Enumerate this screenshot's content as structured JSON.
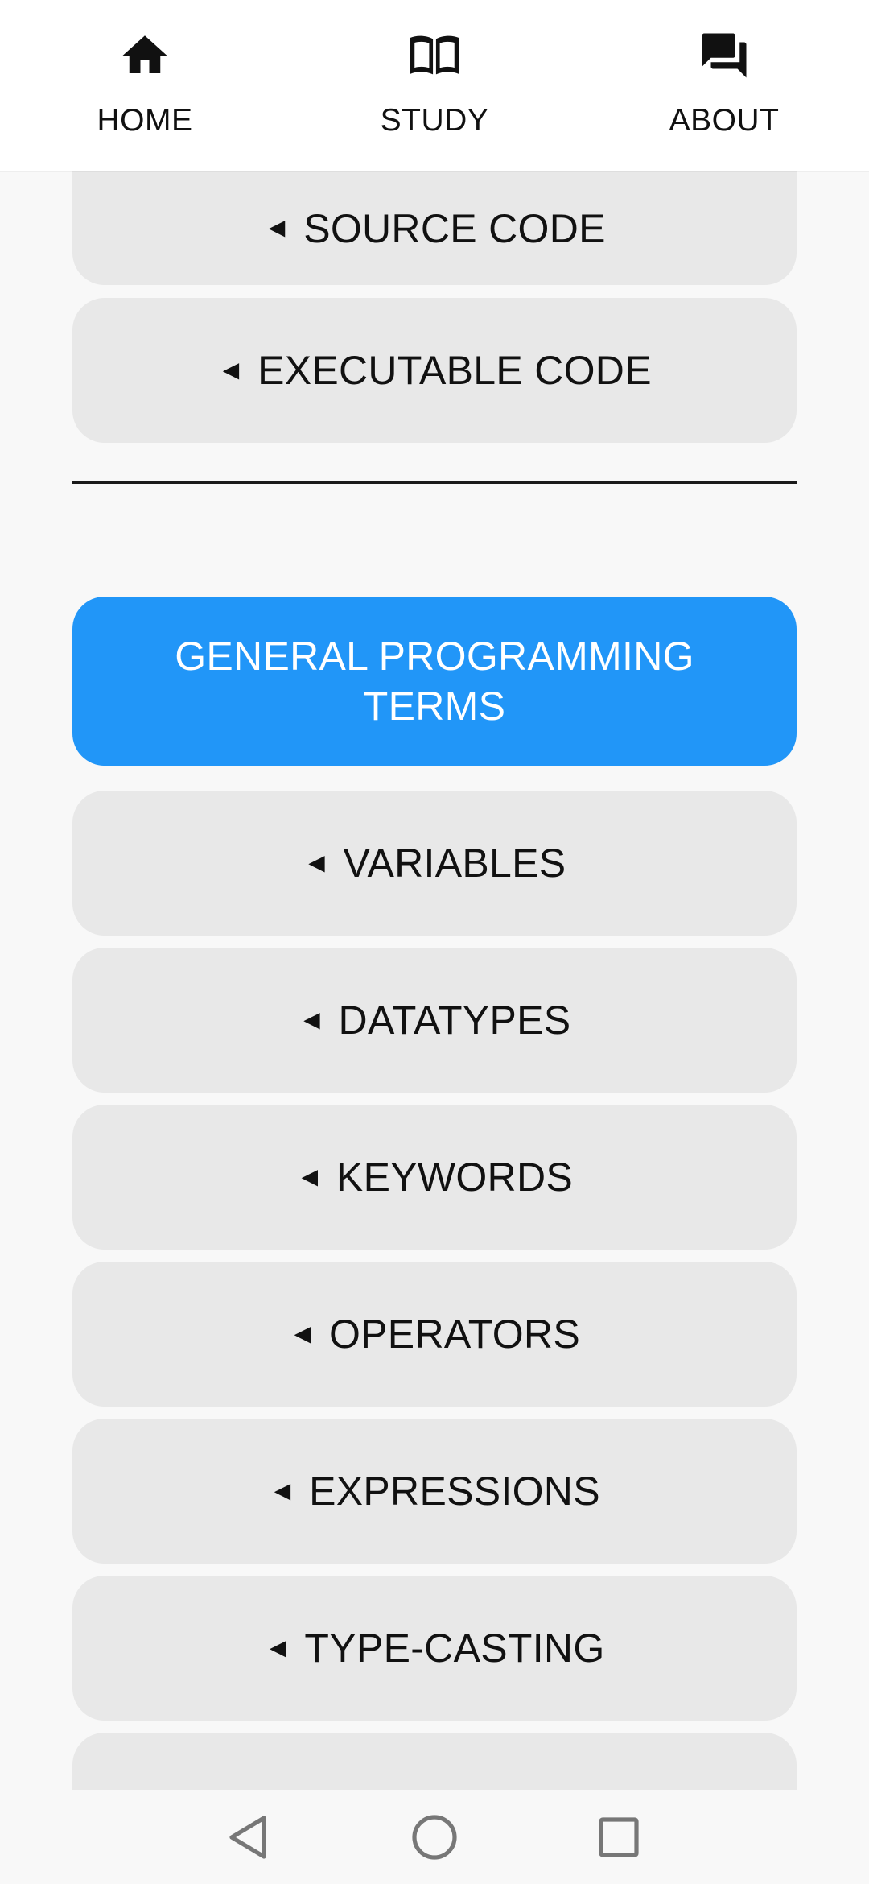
{
  "topnav": {
    "items": [
      {
        "label": "HOME",
        "icon": "home-icon"
      },
      {
        "label": "STUDY",
        "icon": "book-icon"
      },
      {
        "label": "ABOUT",
        "icon": "forum-icon"
      }
    ]
  },
  "content": {
    "source_code": "SOURCE CODE",
    "executable_code": "EXECUTABLE CODE",
    "section_title": "GENERAL PROGRAMMING TERMS",
    "items": [
      "VARIABLES",
      "DATATYPES",
      "KEYWORDS",
      "OPERATORS",
      "EXPRESSIONS",
      "TYPE-CASTING"
    ],
    "arrow_glyph": "◄"
  },
  "colors": {
    "accent": "#2196f8",
    "button_bg": "#e8e8e8",
    "background": "#f8f8f8"
  },
  "system_nav": {
    "icons": [
      "back-icon",
      "home-circle-icon",
      "recents-icon"
    ]
  }
}
